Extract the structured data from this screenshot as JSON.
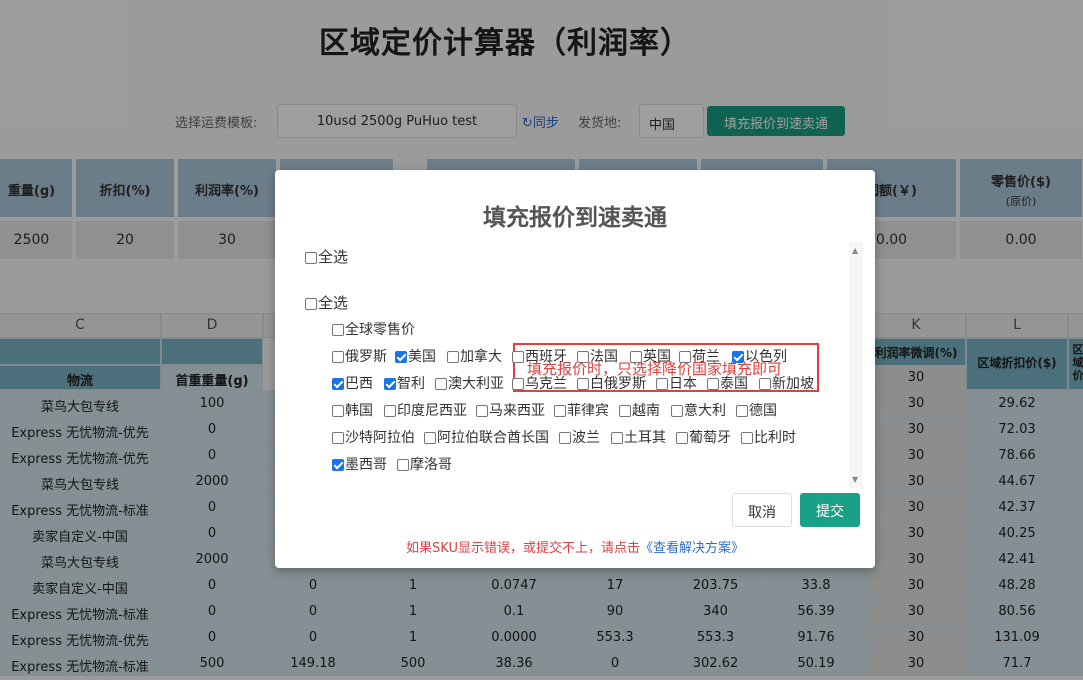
{
  "page": {
    "title": "区域定价计算器（利润率）",
    "template_label": "选择运费模板:",
    "template_value": "10usd 2500g PuHuo test",
    "sync_label": "↻同步",
    "origin_label": "发货地:",
    "origin_value": "中国",
    "fill_button": "填充报价到速卖通"
  },
  "top_table": {
    "headers": [
      "重量(g)",
      "折扣(%)",
      "利润率(%)",
      "",
      "",
      "",
      "",
      "润额(￥)",
      "零售价($)"
    ],
    "sub_header": "(原价)",
    "values": [
      "2500",
      "20",
      "30",
      "",
      "",
      "",
      "",
      "0.00",
      "0.00"
    ]
  },
  "grid": {
    "letters": [
      "C",
      "D",
      "",
      "",
      "",
      "",
      "",
      "",
      "K",
      "L"
    ],
    "headers": {
      "logistics": "物流",
      "first_weight": "首重重量(g)",
      "profit_adjust": "利润率微调(%)",
      "region_discount": "区域折扣价($)",
      "last_partial": "区\n域\n价"
    },
    "rows": [
      {
        "name": "菜鸟大包专线",
        "d": "100",
        "e": "",
        "f": "",
        "g": "",
        "h": "",
        "i": "",
        "j": "",
        "k": "30",
        "l": "29.62"
      },
      {
        "name": "Express 无忧物流-优先",
        "d": "0",
        "e": "",
        "f": "",
        "g": "",
        "h": "",
        "i": "",
        "j": "",
        "k": "30",
        "l": "72.03"
      },
      {
        "name": "Express 无忧物流-优先",
        "d": "0",
        "e": "",
        "f": "",
        "g": "",
        "h": "",
        "i": "",
        "j": "",
        "k": "30",
        "l": "78.66"
      },
      {
        "name": "菜鸟大包专线",
        "d": "2000",
        "e": "",
        "f": "",
        "g": "",
        "h": "",
        "i": "",
        "j": "",
        "k": "30",
        "l": "44.67"
      },
      {
        "name": "Express 无忧物流-标准",
        "d": "0",
        "e": "",
        "f": "",
        "g": "",
        "h": "",
        "i": "",
        "j": "",
        "k": "30",
        "l": "42.37"
      },
      {
        "name": "卖家自定义-中国",
        "d": "0",
        "e": "",
        "f": "",
        "g": "",
        "h": "",
        "i": "",
        "j": "",
        "k": "30",
        "l": "40.25"
      },
      {
        "name": "菜鸟大包专线",
        "d": "2000",
        "e": "",
        "f": "",
        "g": "",
        "h": "",
        "i": "",
        "j": "",
        "k": "30",
        "l": "42.41"
      },
      {
        "name": "卖家自定义-中国",
        "d": "0",
        "e": "0",
        "f": "1",
        "g": "0.0747",
        "h": "17",
        "i": "203.75",
        "j": "33.8",
        "k": "30",
        "l": "48.28"
      },
      {
        "name": "Express 无忧物流-标准",
        "d": "0",
        "e": "0",
        "f": "1",
        "g": "0.1",
        "h": "90",
        "i": "340",
        "j": "56.39",
        "k": "30",
        "l": "80.56"
      },
      {
        "name": "Express 无忧物流-优先",
        "d": "0",
        "e": "0",
        "f": "1",
        "g": "0.0000",
        "h": "553.3",
        "i": "553.3",
        "j": "91.76",
        "k": "30",
        "l": "131.09"
      },
      {
        "name": "Express 无忧物流-标准",
        "d": "500",
        "e": "149.18",
        "f": "500",
        "g": "38.36",
        "h": "0",
        "i": "302.62",
        "j": "50.19",
        "k": "30",
        "l": "71.7"
      }
    ]
  },
  "modal": {
    "title": "填充报价到速卖通",
    "select_all_1": "全选",
    "select_all_2": "全选",
    "global_retail": "全球零售价",
    "warning": "填充报价时，只选择降价国家填充即可",
    "countries": [
      {
        "label": "俄罗斯",
        "checked": false
      },
      {
        "label": "美国",
        "checked": true
      },
      {
        "label": "加拿大",
        "checked": false
      },
      {
        "label": "西班牙",
        "checked": false
      },
      {
        "label": "法国",
        "checked": false
      },
      {
        "label": "英国",
        "checked": false
      },
      {
        "label": "荷兰",
        "checked": false
      },
      {
        "label": "以色列",
        "checked": true
      },
      {
        "label": "巴西",
        "checked": true
      },
      {
        "label": "智利",
        "checked": true
      },
      {
        "label": "澳大利亚",
        "checked": false
      },
      {
        "label": "乌克兰",
        "checked": false
      },
      {
        "label": "白俄罗斯",
        "checked": false
      },
      {
        "label": "日本",
        "checked": false
      },
      {
        "label": "泰国",
        "checked": false
      },
      {
        "label": "新加坡",
        "checked": false
      },
      {
        "label": "韩国",
        "checked": false
      },
      {
        "label": "印度尼西亚",
        "checked": false
      },
      {
        "label": "马来西亚",
        "checked": false
      },
      {
        "label": "菲律宾",
        "checked": false
      },
      {
        "label": "越南",
        "checked": false
      },
      {
        "label": "意大利",
        "checked": false
      },
      {
        "label": "德国",
        "checked": false
      },
      {
        "label": "沙特阿拉伯",
        "checked": false
      },
      {
        "label": "阿拉伯联合酋长国",
        "checked": false
      },
      {
        "label": "波兰",
        "checked": false
      },
      {
        "label": "土耳其",
        "checked": false
      },
      {
        "label": "葡萄牙",
        "checked": false
      },
      {
        "label": "比利时",
        "checked": false
      },
      {
        "label": "墨西哥",
        "checked": true
      },
      {
        "label": "摩洛哥",
        "checked": false
      }
    ],
    "cancel": "取消",
    "submit": "提交",
    "footnote_prefix": "如果SKU显示错误，或提交不上，请点击",
    "footnote_link": "《查看解决方案》"
  }
}
